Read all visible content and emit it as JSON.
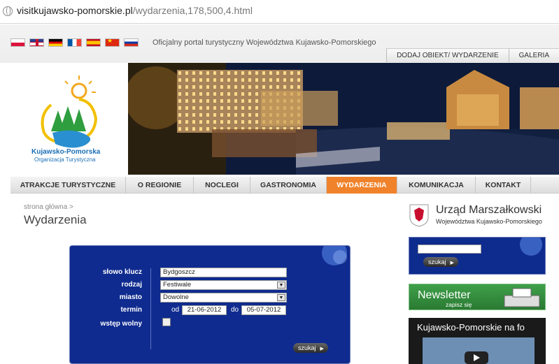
{
  "browser": {
    "url_domain": "visitkujawsko-pomorskie.pl",
    "url_path": "/wydarzenia,178,500,4.html"
  },
  "header": {
    "portal_text": "Oficjalny portal turystyczny Województwa Kujawsko-Pomorskiego",
    "languages": [
      "pl",
      "gb",
      "de",
      "fr",
      "es",
      "cn",
      "ru"
    ],
    "top_buttons": [
      "DODAJ OBIEKT/ WYDARZENIE",
      "GALERIA"
    ]
  },
  "logo": {
    "line1": "Kujawsko-Pomorska",
    "line2": "Organizacja Turystyczna"
  },
  "menu": {
    "items": [
      "ATRAKCJE TURYSTYCZNE",
      "O REGIONIE",
      "NOCLEGI",
      "GASTRONOMIA",
      "WYDARZENIA",
      "KOMUNIKACJA",
      "KONTAKT"
    ],
    "active_index": 4,
    "active_color": "#f0822b"
  },
  "breadcrumb": "strona główna >",
  "page_title": "Wydarzenia",
  "search_form": {
    "keyword_label": "słowo klucz",
    "keyword_value": "Bydgoszcz",
    "type_label": "rodzaj",
    "type_value": "Festiwale",
    "city_label": "miasto",
    "city_value": "Dowolne",
    "date_label": "termin",
    "from_label": "od",
    "from_value": "21-06-2012",
    "to_label": "do",
    "to_value": "05-07-2012",
    "free_label": "wstęp wolny",
    "submit_label": "szukaj",
    "panel_color": "#0f2b8f"
  },
  "sidebar": {
    "um_title": "Urząd Marszałkowski",
    "um_subtitle": "Województwa Kujawsko-Pomorskiego",
    "search_button": "szukaj",
    "newsletter_title": "Newsletter",
    "newsletter_sub": "zapisz się",
    "video_title": "Kujawsko-Pomorskie na fo"
  }
}
